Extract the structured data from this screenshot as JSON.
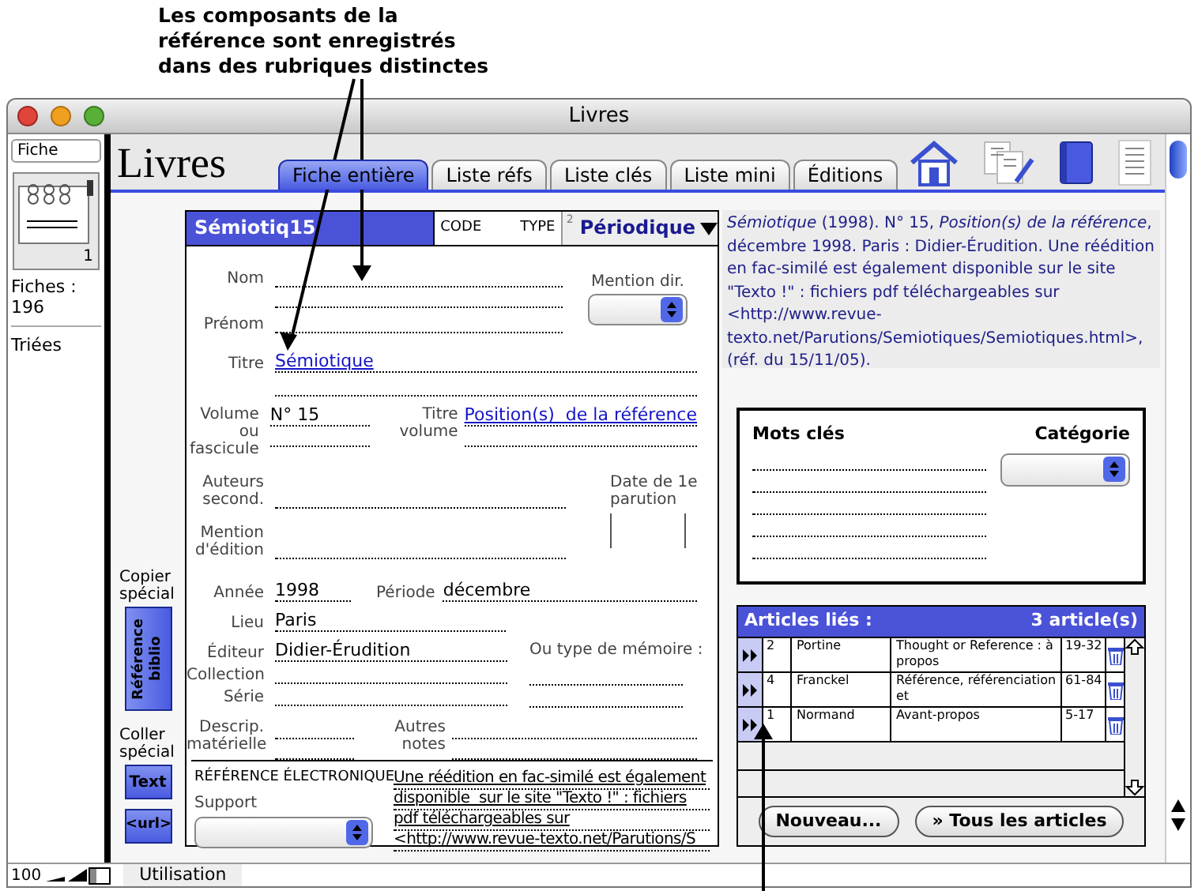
{
  "annotation": {
    "text": "Les composants de la référence sont enregistrés dans des rubriques distinctes"
  },
  "window": {
    "title": "Livres"
  },
  "sidebar": {
    "layout_menu": "Fiche",
    "record_number": "1",
    "fiches_label": "Fiches :",
    "fiches_count": "196",
    "sort_status": "Triées"
  },
  "header": {
    "title": "Livres",
    "tabs": [
      {
        "label": "Fiche entière",
        "selected": true
      },
      {
        "label": "Liste réfs",
        "selected": false
      },
      {
        "label": "Liste clés",
        "selected": false
      },
      {
        "label": "Liste mini",
        "selected": false
      },
      {
        "label": "Éditions",
        "selected": false
      }
    ]
  },
  "tools": {
    "copy_label": "Copier spécial",
    "reference_button": "Référence biblio",
    "paste_label": "Coller spécial",
    "text_button": "Text",
    "url_button": "<url>"
  },
  "record": {
    "code": "Sémiotiq15",
    "code_label": "CODE",
    "type_label": "TYPE",
    "type_number": "2",
    "type_value": "Périodique"
  },
  "form": {
    "nom": {
      "label": "Nom"
    },
    "prenom": {
      "label": "Prénom"
    },
    "mention_dir": {
      "label": "Mention dir."
    },
    "titre": {
      "label": "Titre",
      "value": "Sémiotique"
    },
    "volume": {
      "label": "Volume ou fascicule",
      "value": "N° 15"
    },
    "titre_volume": {
      "label": "Titre volume",
      "value": "Position(s)  de la référence"
    },
    "auteurs": {
      "label": "Auteurs second."
    },
    "date_parution": {
      "label": "Date de 1e parution"
    },
    "mention_edition": {
      "label": "Mention d'édition"
    },
    "annee": {
      "label": "Année",
      "value": "1998"
    },
    "periode": {
      "label": "Période",
      "value": "décembre"
    },
    "lieu": {
      "label": "Lieu",
      "value": "Paris"
    },
    "editeur": {
      "label": "Éditeur",
      "value": "Didier-Érudition"
    },
    "collection": {
      "label": "Collection"
    },
    "serie": {
      "label": "Série"
    },
    "type_memoire": {
      "label": "Ou type de mémoire :"
    },
    "descrip": {
      "label": "Descrip. matérielle"
    },
    "autres_notes": {
      "label": "Autres notes"
    }
  },
  "electronic": {
    "heading": "RÉFÉRENCE ÉLECTRONIQUE",
    "support_label": "Support",
    "lines": [
      "Une réédition en fac-similé est également",
      "disponible  sur le site \"Texto !\" : fichiers",
      "pdf téléchargeables sur",
      "<http://www.revue-texto.net/Parutions/S"
    ]
  },
  "citation": "*Sémiotique* (1998). N° 15, *Position(s)  de la référence*, décembre 1998. Paris : Didier-Érudition. Une réédition en fac-similé est également disponible sur le site \"Texto !\" : fichiers pdf téléchargeables sur <http://www.revue-texto.net/Parutions/Semiotiques/Semiotiques.html>, (réf. du 15/11/05).",
  "keywords": {
    "heading": "Mots clés",
    "category_label": "Catégorie"
  },
  "articles": {
    "title": "Articles liés :",
    "count": "3 article(s)",
    "rows": [
      {
        "number": "2",
        "author": "Portine",
        "title": "Thought or Reference : à propos",
        "pages": "19-32"
      },
      {
        "number": "4",
        "author": "Franckel",
        "title": "Référence, référenciation et",
        "pages": "61-84"
      },
      {
        "number": "1",
        "author": "Normand",
        "title": "Avant-propos",
        "pages": "5-17"
      }
    ],
    "buttons": [
      "Nouveau...",
      "» Tous les articles"
    ]
  },
  "status_bar": {
    "zoom": "100",
    "mode": "Utilisation"
  }
}
